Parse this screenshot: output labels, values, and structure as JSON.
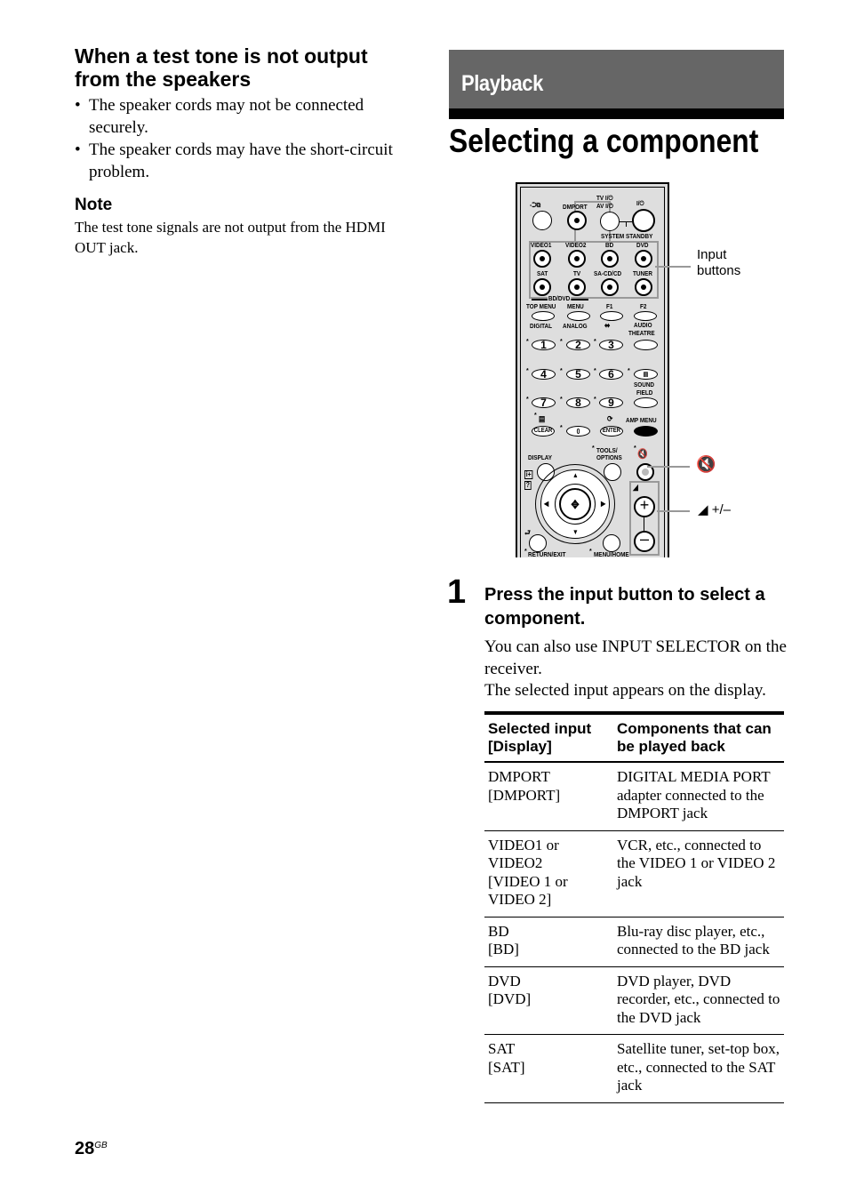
{
  "left_column": {
    "heading": "When a test tone is not output from the speakers",
    "bullets": [
      "The speaker cords may not be connected securely.",
      "The speaker cords may have the short-circuit problem."
    ],
    "note_heading": "Note",
    "note_text": "The test tone signals are not output from the HDMI OUT jack."
  },
  "section": {
    "label": "Playback",
    "title": "Selecting a component"
  },
  "remote": {
    "labels": {
      "input_icon": "-⮊⧉",
      "dmport": "DMPORT",
      "tv_power": "TV I/⏻",
      "av_power": "AV I/⏻",
      "power": "I/⏻",
      "system_standby": "SYSTEM STANDBY",
      "video1": "VIDEO1",
      "video2": "VIDEO2",
      "bd": "BD",
      "dvd": "DVD",
      "sat": "SAT",
      "tv": "TV",
      "sacd": "SA-CD/CD",
      "tuner": "TUNER",
      "bddvd": "BD/DVD",
      "top_menu": "TOP MENU",
      "menu": "MENU",
      "f1": "F1",
      "f2": "F2",
      "digital": "DIGITAL",
      "analog": "ANALOG",
      "wide_icon": "⬌",
      "audio": "AUDIO",
      "theatre": "THEATRE",
      "sound": "SOUND",
      "field": "FIELD",
      "clear": "CLEAR",
      "enter": "ENTER",
      "amp_menu": "AMP MENU",
      "display": "DISPLAY",
      "tools": "TOOLS/",
      "options": "OPTIONS",
      "return_exit": "RETURN/EXIT",
      "menu_home": "MENU/HOME",
      "star": "*"
    },
    "numbers": [
      "1",
      "2",
      "3",
      "4",
      "5",
      "6",
      "7",
      "8",
      "9",
      "0"
    ],
    "callouts": {
      "input_buttons": "Input buttons",
      "mute_icon": "🔇",
      "volume": "+/–"
    }
  },
  "step": {
    "number": "1",
    "title": "Press the input button to select a component.",
    "body": [
      "You can also use INPUT SELECTOR on the receiver.",
      "The selected input appears on the display."
    ]
  },
  "table": {
    "headers": [
      "Selected input [Display]",
      "Components that can be played back"
    ],
    "rows": [
      {
        "input": "DMPORT",
        "display": "[DMPORT]",
        "components": "DIGITAL MEDIA PORT adapter connected to the DMPORT jack"
      },
      {
        "input": "VIDEO1 or VIDEO2",
        "display": "[VIDEO 1 or VIDEO 2]",
        "components": "VCR, etc., connected to the VIDEO 1 or VIDEO 2 jack"
      },
      {
        "input": "BD",
        "display": "[BD]",
        "components": "Blu-ray disc player, etc., connected to the BD jack"
      },
      {
        "input": "DVD",
        "display": "[DVD]",
        "components": "DVD player, DVD recorder, etc., connected to the DVD jack"
      },
      {
        "input": "SAT",
        "display": "[SAT]",
        "components": "Satellite tuner, set-top box, etc., connected to the SAT jack"
      }
    ]
  },
  "footer": {
    "page_number": "28",
    "page_suffix": "GB"
  },
  "colors": {
    "section_bar": "#666666",
    "remote_body": "#dcdcdc",
    "highlight_box": "#999999"
  }
}
